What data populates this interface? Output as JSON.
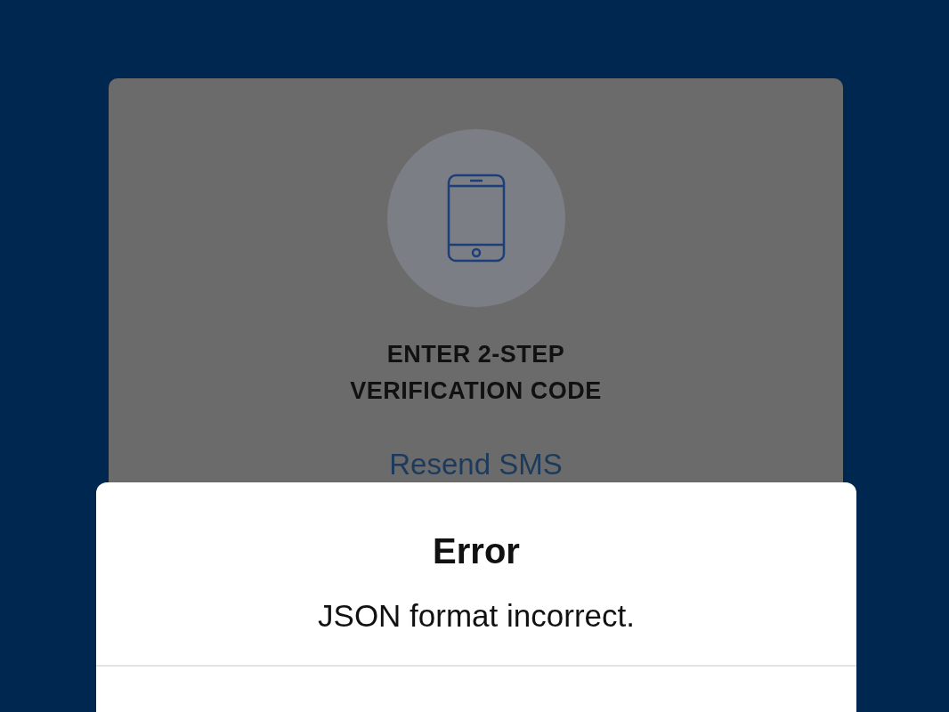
{
  "card": {
    "title": "ENTER 2-STEP VERIFICATION CODE",
    "resend_link": "Resend SMS"
  },
  "dialog": {
    "title": "Error",
    "message": "JSON format incorrect."
  }
}
